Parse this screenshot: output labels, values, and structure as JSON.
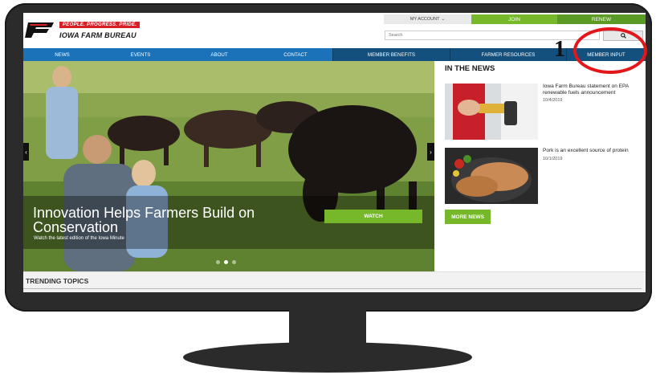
{
  "header": {
    "tagline": "PEOPLE. PROGRESS. PRIDE.",
    "org_name": "IOWA FARM BUREAU",
    "logo_text": "FB"
  },
  "account_bar": {
    "my_account": "MY ACCOUNT",
    "join": "JOIN",
    "renew": "RENEW"
  },
  "search": {
    "placeholder": "Search"
  },
  "nav": {
    "items": [
      "NEWS",
      "EVENTS",
      "ABOUT",
      "CONTACT",
      "MEMBER BENEFITS",
      "FARMER RESOURCES",
      "MEMBER INPUT"
    ]
  },
  "hero": {
    "title": "Innovation Helps Farmers Build on Conservation",
    "subtitle": "Watch the latest edition of the Iowa Minute",
    "watch_button": "WATCH",
    "slide_count": 3,
    "active_slide": 2
  },
  "news": {
    "heading": "IN THE NEWS",
    "items": [
      {
        "title": "Iowa Farm Bureau statement on EPA renewable fuels announcement",
        "date": "10/4/2019"
      },
      {
        "title": "Pork is an excellent source of protein",
        "date": "10/1/2019"
      }
    ],
    "more_button": "MORE NEWS"
  },
  "trending": {
    "label": "TRENDING TOPICS"
  },
  "annotation": {
    "number": "1"
  },
  "colors": {
    "green": "#76b82a",
    "nav_blue": "#1b72b9",
    "nav_dark_blue": "#13507e",
    "brand_red": "#d71f26",
    "annotation_red": "#e3161b"
  }
}
